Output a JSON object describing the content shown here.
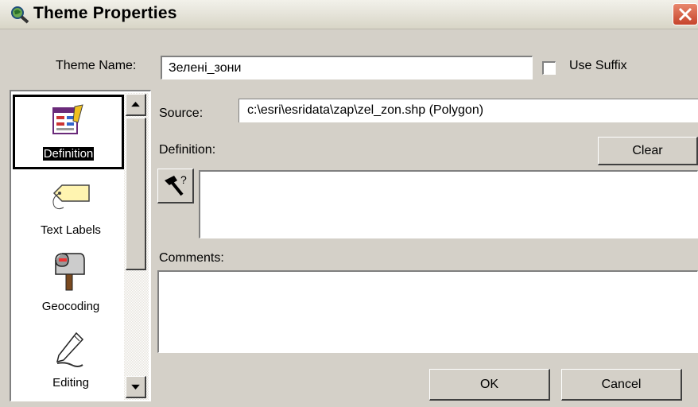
{
  "window": {
    "title": "Theme Properties"
  },
  "theme_name": {
    "label": "Theme Name:",
    "value": "Зелені_зони"
  },
  "use_suffix": {
    "label": "Use Suffix",
    "checked": false
  },
  "categories": [
    {
      "label": "Definition",
      "icon": "definition-icon",
      "selected": true
    },
    {
      "label": "Text Labels",
      "icon": "tag-icon",
      "selected": false
    },
    {
      "label": "Geocoding",
      "icon": "mailbox-icon",
      "selected": false
    },
    {
      "label": "Editing",
      "icon": "pencil-icon",
      "selected": false
    }
  ],
  "source": {
    "label": "Source:",
    "value": "c:\\esri\\esridata\\zap\\zel_zon.shp (Polygon)"
  },
  "definition": {
    "label": "Definition:",
    "clear_label": "Clear",
    "value": ""
  },
  "comments": {
    "label": "Comments:",
    "value": ""
  },
  "buttons": {
    "ok": "OK",
    "cancel": "Cancel"
  },
  "colors": {
    "titlebar": "#e6e4d8",
    "close": "#d2583d",
    "face": "#d4d0c8",
    "selection": "#000000"
  }
}
